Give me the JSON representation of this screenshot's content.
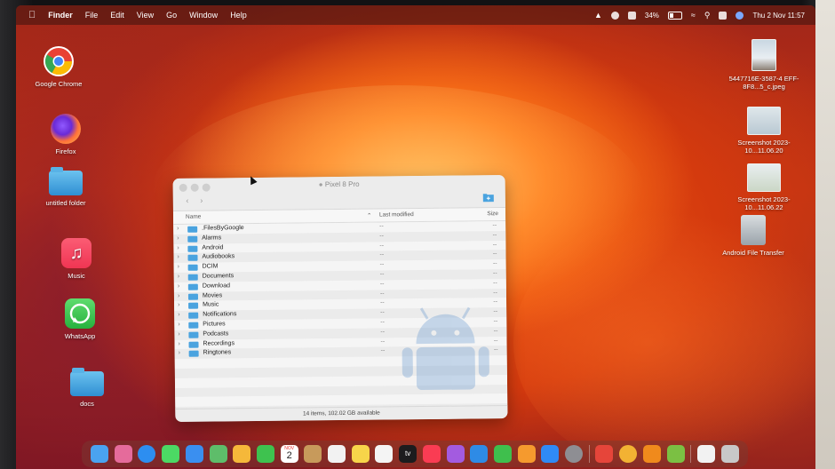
{
  "menubar": {
    "apple": "",
    "app_name": "Finder",
    "menus": [
      "File",
      "Edit",
      "View",
      "Go",
      "Window",
      "Help"
    ],
    "battery": "34%",
    "clock": "Thu 2 Nov  11:57"
  },
  "desktop_left": [
    {
      "label": "Google Chrome",
      "icon": "chrome-icon"
    },
    {
      "label": "Firefox",
      "icon": "firefox-icon"
    },
    {
      "label": "untitled folder",
      "icon": "folder-icon"
    },
    {
      "label": "Music",
      "icon": "music-icon"
    },
    {
      "label": "WhatsApp",
      "icon": "whatsapp-icon"
    },
    {
      "label": "docs",
      "icon": "folder-icon"
    }
  ],
  "desktop_right": [
    {
      "label": "5447716E-3587-4 EFF-8F8...5_c.jpeg",
      "icon": "image-thumb-icon"
    },
    {
      "label": "Screenshot 2023-10...11.06.20",
      "icon": "screenshot-thumb-icon"
    },
    {
      "label": "Screenshot 2023-10...11.06.22",
      "icon": "screenshot-thumb-icon"
    },
    {
      "label": "Android File Transfer",
      "icon": "android-file-transfer-icon"
    }
  ],
  "finder": {
    "title": "Pixel 8 Pro",
    "columns": {
      "name": "Name",
      "modified": "Last modified",
      "size": "Size"
    },
    "items": [
      {
        "name": ".FilesByGoogle",
        "modified": "--",
        "size": "--"
      },
      {
        "name": "Alarms",
        "modified": "--",
        "size": "--"
      },
      {
        "name": "Android",
        "modified": "--",
        "size": "--"
      },
      {
        "name": "Audiobooks",
        "modified": "--",
        "size": "--"
      },
      {
        "name": "DCIM",
        "modified": "--",
        "size": "--"
      },
      {
        "name": "Documents",
        "modified": "--",
        "size": "--"
      },
      {
        "name": "Download",
        "modified": "--",
        "size": "--"
      },
      {
        "name": "Movies",
        "modified": "--",
        "size": "--"
      },
      {
        "name": "Music",
        "modified": "--",
        "size": "--"
      },
      {
        "name": "Notifications",
        "modified": "--",
        "size": "--"
      },
      {
        "name": "Pictures",
        "modified": "--",
        "size": "--"
      },
      {
        "name": "Podcasts",
        "modified": "--",
        "size": "--"
      },
      {
        "name": "Recordings",
        "modified": "--",
        "size": "--"
      },
      {
        "name": "Ringtones",
        "modified": "--",
        "size": "--"
      }
    ],
    "status": "14 items, 102.02 GB available"
  },
  "dock": {
    "calendar_month": "NOV",
    "calendar_day": "2",
    "apple_tv_label": "tv",
    "icons": [
      {
        "name": "finder-icon",
        "color": "#4aa3f0"
      },
      {
        "name": "launchpad-icon",
        "color": "#e56b9b"
      },
      {
        "name": "safari-icon",
        "color": "#2d8ef0"
      },
      {
        "name": "messages-icon",
        "color": "#4cd964"
      },
      {
        "name": "mail-icon",
        "color": "#3a8ff0"
      },
      {
        "name": "maps-icon",
        "color": "#5ebd6a"
      },
      {
        "name": "photos-icon",
        "color": "#f5b83a"
      },
      {
        "name": "facetime-icon",
        "color": "#3ec24f"
      },
      {
        "name": "calendar-icon",
        "color": "#ffffff"
      },
      {
        "name": "contacts-icon",
        "color": "#c79a5b"
      },
      {
        "name": "reminders-icon",
        "color": "#f2f2f2"
      },
      {
        "name": "notes-icon",
        "color": "#f7d54a"
      },
      {
        "name": "freeform-icon",
        "color": "#f4f4f4"
      },
      {
        "name": "apple-tv-icon",
        "color": "#1c1c1e"
      },
      {
        "name": "music-icon",
        "color": "#fa3c53"
      },
      {
        "name": "podcasts-icon",
        "color": "#a35be0"
      },
      {
        "name": "keynote-icon",
        "color": "#2e8be6"
      },
      {
        "name": "numbers-icon",
        "color": "#3fbf4d"
      },
      {
        "name": "pages-icon",
        "color": "#f59a2e"
      },
      {
        "name": "app-store-icon",
        "color": "#2f8af5"
      },
      {
        "name": "system-settings-icon",
        "color": "#8e8e93"
      },
      {
        "name": "separator",
        "color": ""
      },
      {
        "name": "anydesk-icon",
        "color": "#e6453a"
      },
      {
        "name": "chrome-icon",
        "color": "#f2b233"
      },
      {
        "name": "vlc-icon",
        "color": "#f08a1c"
      },
      {
        "name": "android-file-transfer-icon",
        "color": "#7bc043"
      },
      {
        "name": "separator",
        "color": ""
      },
      {
        "name": "document-icon",
        "color": "#f2f2f2"
      },
      {
        "name": "trash-icon",
        "color": "#c8c8c8"
      }
    ]
  }
}
